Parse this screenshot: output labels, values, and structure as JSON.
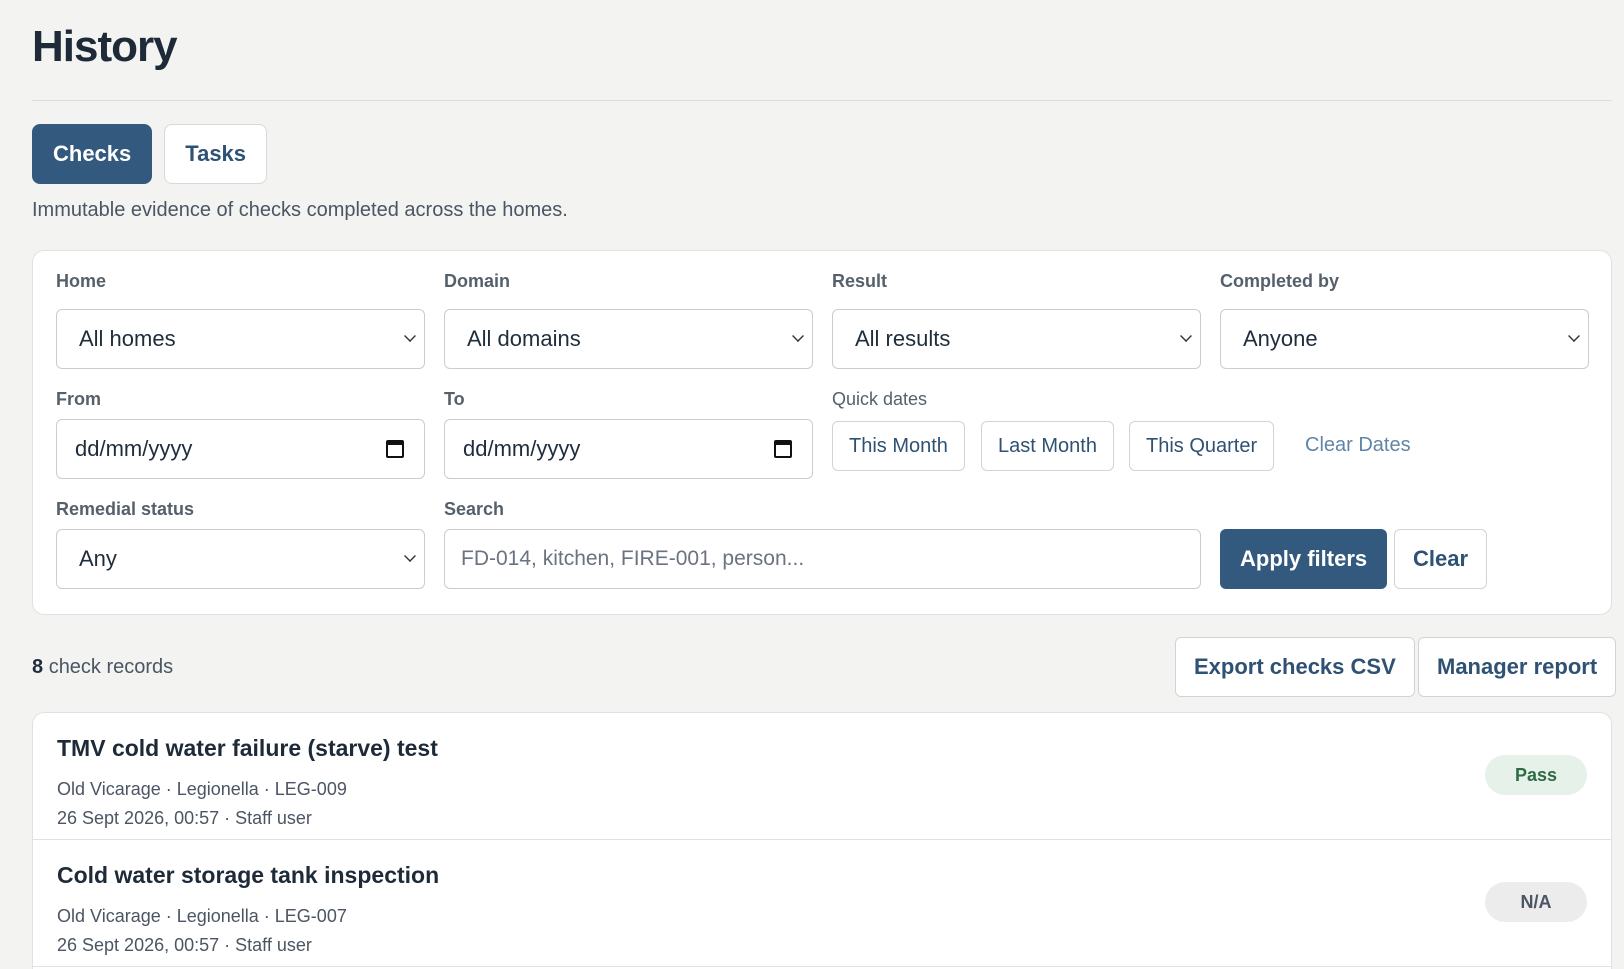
{
  "page": {
    "title": "History",
    "subtitle": "Immutable evidence of checks completed across the homes."
  },
  "tabs": [
    {
      "label": "Checks",
      "active": true
    },
    {
      "label": "Tasks",
      "active": false
    }
  ],
  "filters": {
    "home": {
      "label": "Home",
      "value": "All homes"
    },
    "domain": {
      "label": "Domain",
      "value": "All domains"
    },
    "result": {
      "label": "Result",
      "value": "All results"
    },
    "completed_by": {
      "label": "Completed by",
      "value": "Anyone"
    },
    "from": {
      "label": "From",
      "value": "dd/mm/yyyy"
    },
    "to": {
      "label": "To",
      "value": "dd/mm/yyyy"
    },
    "quick_dates": {
      "label": "Quick dates",
      "buttons": [
        "This Month",
        "Last Month",
        "This Quarter"
      ],
      "clear_label": "Clear Dates"
    },
    "remedial": {
      "label": "Remedial status",
      "value": "Any"
    },
    "search": {
      "label": "Search",
      "placeholder": "FD-014, kitchen, FIRE-001, person..."
    },
    "apply_label": "Apply filters",
    "clear_label": "Clear"
  },
  "summary": {
    "count": "8",
    "count_suffix": "check records",
    "export_label": "Export checks CSV",
    "report_label": "Manager report"
  },
  "records": [
    {
      "title": "TMV cold water failure (starve) test",
      "meta1": "Old Vicarage · Legionella · LEG-009",
      "meta2": "26 Sept 2026, 00:57 · Staff user",
      "result": "Pass"
    },
    {
      "title": "Cold water storage tank inspection",
      "meta1": "Old Vicarage · Legionella · LEG-007",
      "meta2": "26 Sept 2026, 00:57 · Staff user",
      "result": "N/A"
    }
  ],
  "colors": {
    "primary": "#335a7e",
    "pass_bg": "#e6f1ea",
    "pass_text": "#2e6b44",
    "na_bg": "#ececec"
  }
}
